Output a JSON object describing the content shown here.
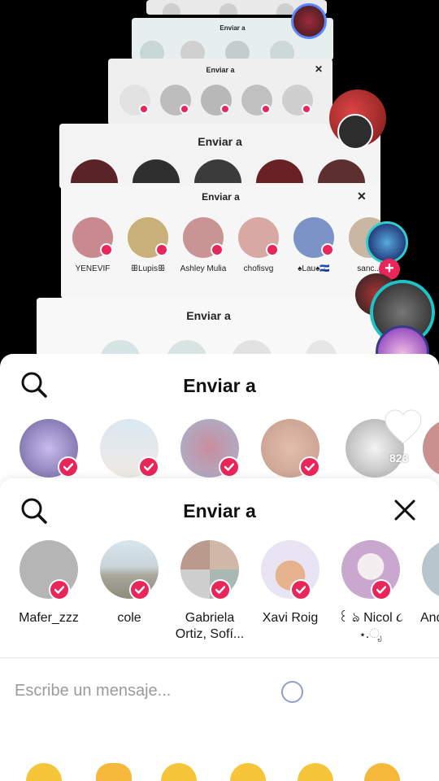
{
  "ghost_sheets": {
    "title": "Enviar a",
    "contacts": [
      "YENEVIF",
      "ꕥLupisꕥ",
      "Ashley Mulia",
      "chofisvg",
      "♠Lau♠🇸🇻",
      "sanc..."
    ]
  },
  "middle_sheet": {
    "title": "Enviar a",
    "likes_count": "823"
  },
  "front_sheet": {
    "title": "Enviar a",
    "contacts": [
      {
        "name": "Mafer_zzz"
      },
      {
        "name": "cole"
      },
      {
        "name": "Gabriela Ortiz, Sofí..."
      },
      {
        "name": "Xavi Roig"
      },
      {
        "name": "꒰ ঌ Nicol ૮ ⋆.ೃ"
      },
      {
        "name": "And"
      }
    ],
    "message_placeholder": "Escribe un mensaje..."
  },
  "colors": {
    "accent": "#e8265a",
    "text": "#161616",
    "placeholder": "#9b9b9b"
  },
  "icons": [
    "search-icon",
    "close-icon",
    "check-icon",
    "heart-icon",
    "plus-icon",
    "loading-spinner-icon"
  ],
  "emoji_reactions": [
    "smiling-face-with-hearts",
    "thumbs-up",
    "face-with-tears-of-joy",
    "smiling-face-with-sunglasses",
    "crying-face",
    "folded-hands"
  ]
}
